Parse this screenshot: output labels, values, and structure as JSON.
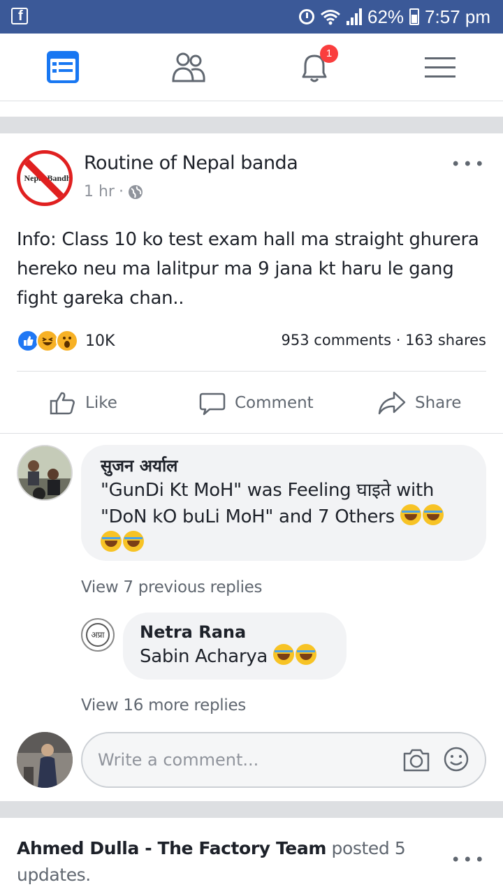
{
  "status_bar": {
    "battery": "62%",
    "time": "7:57 pm"
  },
  "nav": {
    "notification_count": "1"
  },
  "post": {
    "page_name": "Routine of Nepal banda",
    "avatar_text": "Nepal Bandh",
    "time": "1 hr",
    "text": "Info: Class 10 ko test exam hall ma straight ghurera hereko neu ma lalitpur ma 9 jana kt haru le gang fight gareka chan..",
    "reaction_count": "10K",
    "comments": "953 comments",
    "shares": "163 shares",
    "actions": {
      "like": "Like",
      "comment": "Comment",
      "share": "Share"
    }
  },
  "comments": [
    {
      "author": "सुजन अर्याल",
      "text": "\"GunDi Kt MoH\" was Feeling घाइते with \"DoN kO buLi MoH\" and 7 Others"
    },
    {
      "author": "Netra Rana",
      "text": "Sabin Acharya",
      "avatar_text": "अप्रा"
    }
  ],
  "view_previous_replies": "View 7 previous replies",
  "view_more_replies": "View 16 more replies",
  "write_comment_placeholder": "Write a comment...",
  "next_post": {
    "author": "Ahmed Dulla - The Factory Team",
    "action": "posted 5 updates."
  },
  "colors": {
    "brand": "#3b5998",
    "accent": "#1877f2",
    "badge": "#fa3e3e"
  }
}
